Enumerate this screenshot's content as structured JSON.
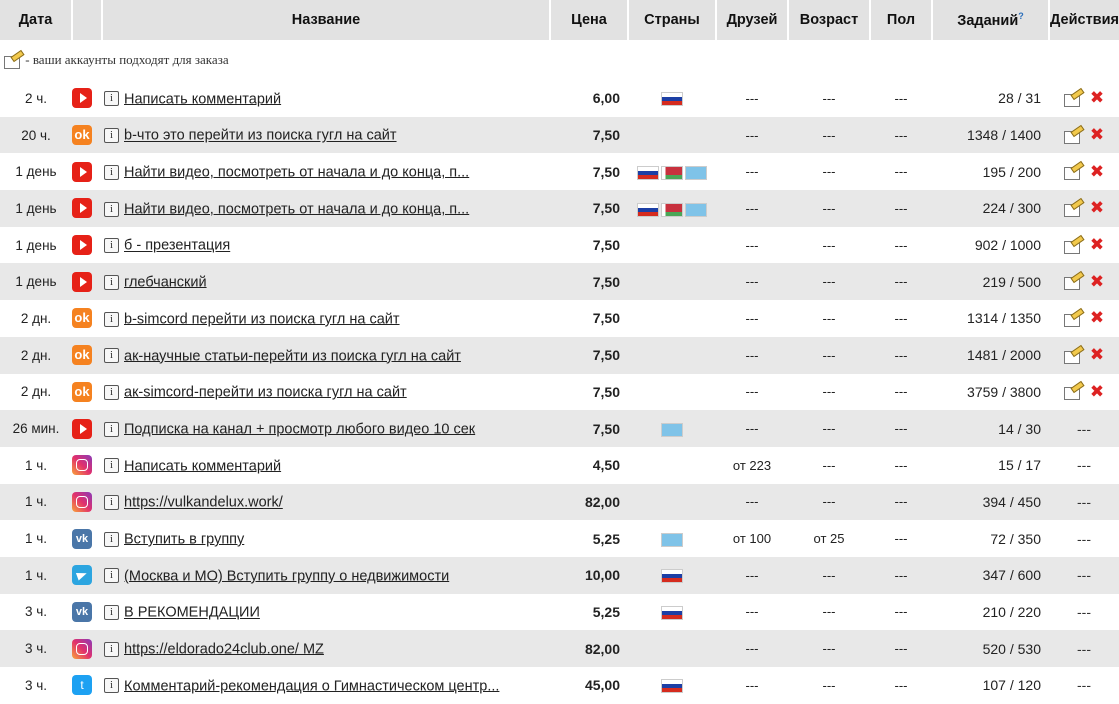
{
  "headers": {
    "date": "Дата",
    "name": "Название",
    "price": "Цена",
    "countries": "Страны",
    "friends": "Друзей",
    "age": "Возраст",
    "sex": "Пол",
    "tasks": "Заданий",
    "tasks_help": "?",
    "actions": "Действия"
  },
  "notice": "- ваши аккаунты подходят для заказа",
  "rows": [
    {
      "date": "2 ч.",
      "service": "youtube",
      "name": "Написать комментарий",
      "price": "6,00",
      "flags": [
        "ru"
      ],
      "friends": "---",
      "age": "---",
      "sex": "---",
      "tasks": "28 / 31",
      "actions": true
    },
    {
      "date": "20 ч.",
      "service": "ok",
      "name": "b-что это перейти из поиска гугл на сайт",
      "price": "7,50",
      "flags": [],
      "friends": "---",
      "age": "---",
      "sex": "---",
      "tasks": "1348 / 1400",
      "actions": true
    },
    {
      "date": "1 день",
      "service": "youtube",
      "name": "Найти видео, посмотреть от начала и до конца, п...",
      "price": "7,50",
      "flags": [
        "ru",
        "by",
        "kz"
      ],
      "friends": "---",
      "age": "---",
      "sex": "---",
      "tasks": "195 / 200",
      "actions": true
    },
    {
      "date": "1 день",
      "service": "youtube",
      "name": "Найти видео, посмотреть от начала и до конца, п...",
      "price": "7,50",
      "flags": [
        "ru",
        "by",
        "kz"
      ],
      "friends": "---",
      "age": "---",
      "sex": "---",
      "tasks": "224 / 300",
      "actions": true
    },
    {
      "date": "1 день",
      "service": "youtube",
      "name": "б - презентация",
      "price": "7,50",
      "flags": [],
      "friends": "---",
      "age": "---",
      "sex": "---",
      "tasks": "902 / 1000",
      "actions": true
    },
    {
      "date": "1 день",
      "service": "youtube",
      "name": "глебчанский",
      "price": "7,50",
      "flags": [],
      "friends": "---",
      "age": "---",
      "sex": "---",
      "tasks": "219 / 500",
      "actions": true
    },
    {
      "date": "2 дн.",
      "service": "ok",
      "name": "b-simcord перейти из поиска гугл на сайт",
      "price": "7,50",
      "flags": [],
      "friends": "---",
      "age": "---",
      "sex": "---",
      "tasks": "1314 / 1350",
      "actions": true
    },
    {
      "date": "2 дн.",
      "service": "ok",
      "name": "ак-научные статьи-перейти из поиска гугл на сайт",
      "price": "7,50",
      "flags": [],
      "friends": "---",
      "age": "---",
      "sex": "---",
      "tasks": "1481 / 2000",
      "actions": true
    },
    {
      "date": "2 дн.",
      "service": "ok",
      "name": "ак-simcord-перейти из поиска гугл на сайт",
      "price": "7,50",
      "flags": [],
      "friends": "---",
      "age": "---",
      "sex": "---",
      "tasks": "3759 / 3800",
      "actions": true
    },
    {
      "date": "26 мин.",
      "service": "youtube",
      "name": "Подписка на канал + просмотр любого видео 10 сек",
      "price": "7,50",
      "flags": [
        "kz"
      ],
      "friends": "---",
      "age": "---",
      "sex": "---",
      "tasks": "14 / 30",
      "actions": false
    },
    {
      "date": "1 ч.",
      "service": "instagram",
      "name": "Написать комментарий",
      "price": "4,50",
      "flags": [],
      "friends": "от 223",
      "age": "---",
      "sex": "---",
      "tasks": "15 / 17",
      "actions": false
    },
    {
      "date": "1 ч.",
      "service": "instagram",
      "name": "https://vulkandelux.work/",
      "price": "82,00",
      "flags": [],
      "friends": "---",
      "age": "---",
      "sex": "---",
      "tasks": "394 / 450",
      "actions": false
    },
    {
      "date": "1 ч.",
      "service": "vk",
      "name": "Вступить в группу",
      "price": "5,25",
      "flags": [
        "kz"
      ],
      "friends": "от 100",
      "age": "от 25",
      "sex": "---",
      "tasks": "72 / 350",
      "actions": false
    },
    {
      "date": "1 ч.",
      "service": "telegram",
      "name": "(Москва и МО) Вступить группу о недвижимости",
      "price": "10,00",
      "flags": [
        "ru"
      ],
      "friends": "---",
      "age": "---",
      "sex": "---",
      "tasks": "347 / 600",
      "actions": false
    },
    {
      "date": "3 ч.",
      "service": "vk",
      "name": "В РЕКОМЕНДАЦИИ",
      "price": "5,25",
      "flags": [
        "ru"
      ],
      "friends": "---",
      "age": "---",
      "sex": "---",
      "tasks": "210 / 220",
      "actions": false
    },
    {
      "date": "3 ч.",
      "service": "instagram",
      "name": "https://eldorado24club.one/ MZ",
      "price": "82,00",
      "flags": [],
      "friends": "---",
      "age": "---",
      "sex": "---",
      "tasks": "520 / 530",
      "actions": false
    },
    {
      "date": "3 ч.",
      "service": "twitter",
      "name": "Комментарий-рекомендация о Гимнастическом центр...",
      "price": "45,00",
      "flags": [
        "ru"
      ],
      "friends": "---",
      "age": "---",
      "sex": "---",
      "tasks": "107 / 120",
      "actions": false
    }
  ],
  "actions_empty": "---",
  "service_glyphs": {
    "ok": "ok",
    "vk": "vk",
    "twitter": "t"
  },
  "info_glyph": "i"
}
